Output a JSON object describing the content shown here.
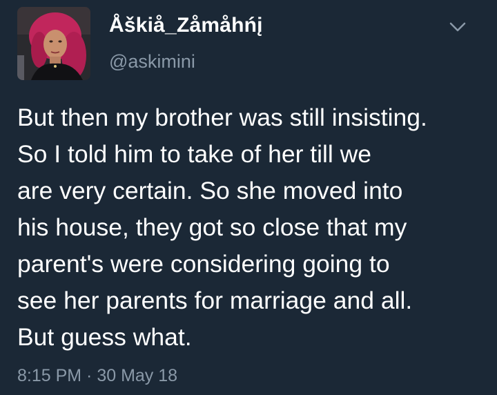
{
  "tweet": {
    "author": {
      "display_name": "Åškiå_Zåmåhńį",
      "handle": "@askimini",
      "avatar": "profile-photo"
    },
    "menu_icon": "chevron-down-icon",
    "text_lines": [
      "But then my brother was still insisting.",
      "So I told him to take of her till we",
      "are very certain. So she moved into",
      "his house, they got so close that my",
      "parent's were considering going to",
      "see her parents for marriage and all.",
      "But guess what."
    ],
    "timestamp": "8:15 PM · 30 May 18"
  },
  "colors": {
    "background": "#1b2836",
    "text": "#ffffff",
    "secondary_text": "#8a99a8"
  }
}
